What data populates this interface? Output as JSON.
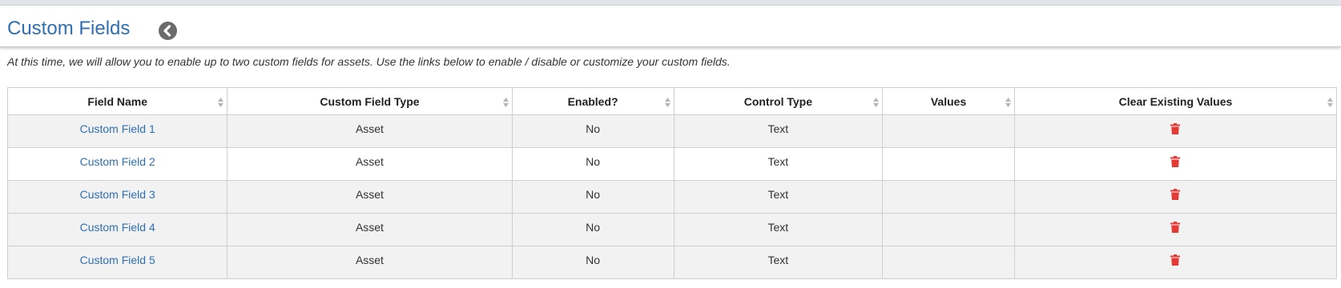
{
  "page": {
    "title": "Custom Fields",
    "description": "At this time, we will allow you to enable up to two custom fields for assets. Use the links below to enable / disable or customize your custom fields."
  },
  "table": {
    "columns": [
      "Field Name",
      "Custom Field Type",
      "Enabled?",
      "Control Type",
      "Values",
      "Clear Existing Values"
    ],
    "rows": [
      {
        "field_name": "Custom Field 1",
        "type": "Asset",
        "enabled": "No",
        "control_type": "Text",
        "values": ""
      },
      {
        "field_name": "Custom Field 2",
        "type": "Asset",
        "enabled": "No",
        "control_type": "Text",
        "values": ""
      },
      {
        "field_name": "Custom Field 3",
        "type": "Asset",
        "enabled": "No",
        "control_type": "Text",
        "values": ""
      },
      {
        "field_name": "Custom Field 4",
        "type": "Asset",
        "enabled": "No",
        "control_type": "Text",
        "values": ""
      },
      {
        "field_name": "Custom Field 5",
        "type": "Asset",
        "enabled": "No",
        "control_type": "Text",
        "values": ""
      }
    ]
  },
  "icons": {
    "back": "chevron-left-circle-icon",
    "sort": "sort-icon",
    "clear": "trash-icon"
  },
  "colors": {
    "accent": "#2f6fb2",
    "delete": "#e53935",
    "row_alt": "#f2f2f2"
  }
}
